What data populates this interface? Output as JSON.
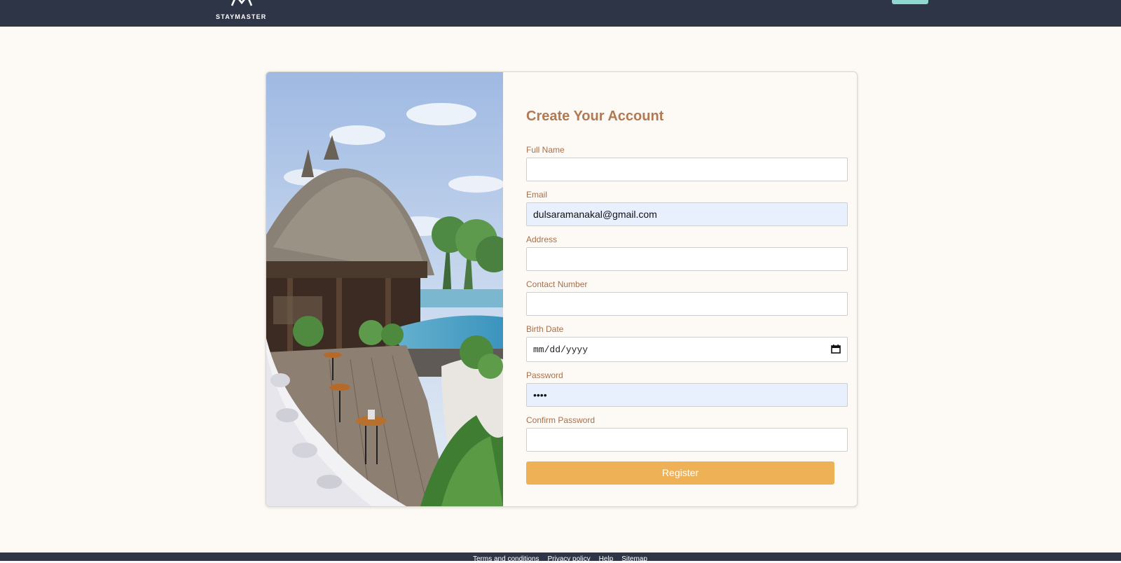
{
  "header": {
    "brand": "STAYMASTER"
  },
  "form": {
    "title": "Create Your Account",
    "fields": {
      "full_name": {
        "label": "Full Name",
        "value": ""
      },
      "email": {
        "label": "Email",
        "value": "dulsaramanakal@gmail.com"
      },
      "address": {
        "label": "Address",
        "value": ""
      },
      "contact": {
        "label": "Contact Number",
        "value": ""
      },
      "birth_date": {
        "label": "Birth Date",
        "placeholder": "mm/dd/yyyy"
      },
      "password": {
        "label": "Password",
        "value": "••••"
      },
      "confirm_password": {
        "label": "Confirm Password",
        "value": ""
      }
    },
    "register_label": "Register"
  },
  "footer": {
    "links": [
      "Terms and conditions",
      "Privacy policy",
      "Help",
      "Sitemap"
    ]
  },
  "colors": {
    "topbar": "#2e3547",
    "accent": "#eeb155",
    "title": "#b07a54",
    "autofill": "#e8f0fe"
  }
}
